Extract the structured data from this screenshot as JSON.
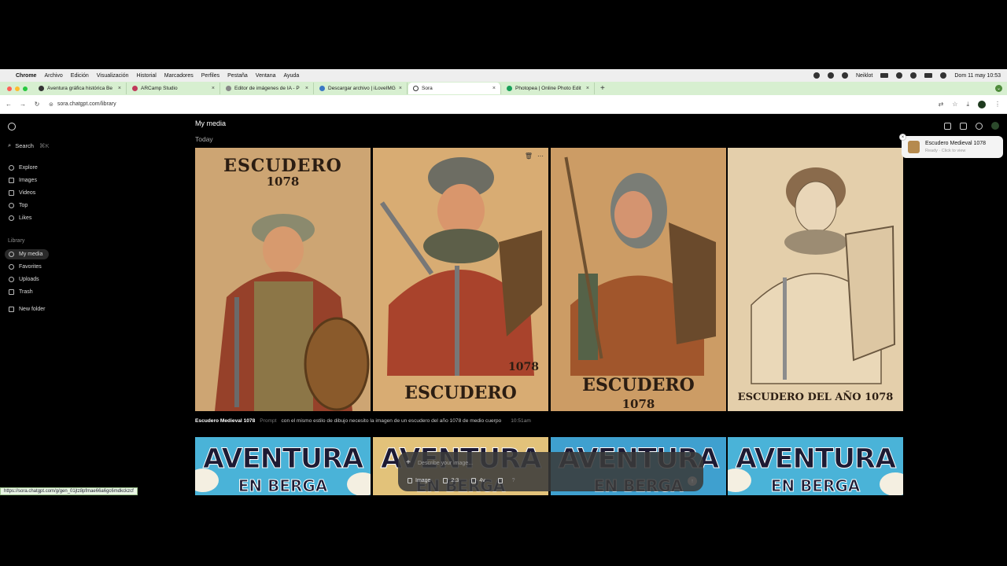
{
  "menubar": {
    "app_name": "Chrome",
    "items": [
      "Archivo",
      "Edición",
      "Visualización",
      "Historial",
      "Marcadores",
      "Perfiles",
      "Pestaña",
      "Ventana",
      "Ayuda"
    ],
    "user": "Neiklot",
    "clock": "Dom 11 may 10:53"
  },
  "tabs": [
    {
      "title": "Aventura gráfica histórica Be"
    },
    {
      "title": "ARCamp Studio"
    },
    {
      "title": "Editor de imágenes de IA - P"
    },
    {
      "title": "Descargar archivo | iLoveIMG"
    },
    {
      "title": "Sora"
    },
    {
      "title": "Photopea | Online Photo Edit"
    }
  ],
  "url": "sora.chatgpt.com/library",
  "sidebar": {
    "search_label": "Search",
    "search_shortcut": "⌘K",
    "nav": [
      {
        "label": "Explore",
        "icon": "compass-icon"
      },
      {
        "label": "Images",
        "icon": "image-icon"
      },
      {
        "label": "Videos",
        "icon": "video-icon"
      },
      {
        "label": "Top",
        "icon": "trophy-icon"
      },
      {
        "label": "Likes",
        "icon": "heart-icon"
      }
    ],
    "library_label": "Library",
    "library": [
      {
        "label": "My media",
        "icon": "media-icon"
      },
      {
        "label": "Favorites",
        "icon": "star-icon"
      },
      {
        "label": "Uploads",
        "icon": "upload-icon"
      },
      {
        "label": "Trash",
        "icon": "trash-icon"
      }
    ],
    "new_folder": "New folder"
  },
  "main": {
    "title": "My media",
    "date_group": "Today",
    "images": [
      {
        "top": "ESCUDERO",
        "year": "1078",
        "bg": "#caa170"
      },
      {
        "year": "1078",
        "bottom": "ESCUDERO",
        "bg": "#d6ab72"
      },
      {
        "bottom": "ESCUDERO",
        "year": "1078",
        "bg": "#c99b64"
      },
      {
        "bottom": "ESCUDERO DEL AÑO 1078",
        "bg": "#e3ceaa"
      }
    ],
    "caption": {
      "title": "Escudero Medieval 1078",
      "label": "Prompt",
      "prompt": "con el mismo estilo de dibujo necesito la imagen de un escudero del año 1078 de medio cuerpo",
      "time": "10:51am"
    },
    "posters": [
      {
        "line1": "AVENTURA",
        "line2": "EN BERGA"
      },
      {
        "line1": "AVENTURA",
        "line2": "EN BERGA"
      },
      {
        "line1": "AVENTURA",
        "line2": "EN BERGA"
      },
      {
        "line1": "AVENTURA",
        "line2": "EN BERGA"
      }
    ]
  },
  "composer": {
    "placeholder": "Describe your image...",
    "type": "Image",
    "ratio": "2:3",
    "variations": "4v",
    "help": "?"
  },
  "toast": {
    "title": "Escudero Medieval 1078",
    "subtitle": "Ready · Click to view"
  },
  "status_url": "https://sora.chatgpt.com/g/gen_01jtz8pfmae66a6gc6mdkckzcf"
}
